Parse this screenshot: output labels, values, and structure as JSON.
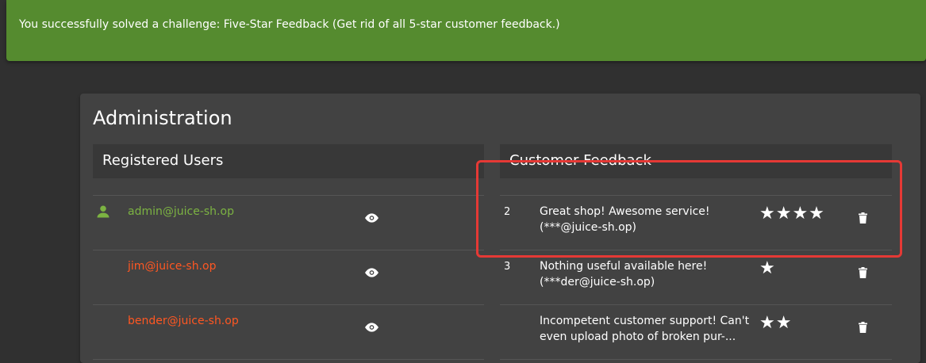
{
  "notification": {
    "message": "You successfully solved a challenge: Five-Star Feedback (Get rid of all 5-star customer feedback.)",
    "color": "#558b2f"
  },
  "administration": {
    "title": "Administration",
    "registered_users": {
      "header": "Registered Users",
      "users": [
        {
          "email": "admin@juice-sh.op",
          "color": "#7cb342",
          "icon": "user-icon"
        },
        {
          "email": "jim@juice-sh.op",
          "color": "#ff5722"
        },
        {
          "email": "bender@juice-sh.op",
          "color": "#ff5722"
        }
      ]
    },
    "customer_feedback": {
      "header": "Customer Feedback",
      "feedbacks": [
        {
          "id": "2",
          "comment": "Great shop! Awesome service! (***@juice-sh.op)",
          "rating": 4,
          "stars": "★★★★"
        },
        {
          "id": "3",
          "comment": "Nothing useful available here! (***der@juice-sh.op)",
          "rating": 1,
          "stars": "★"
        },
        {
          "id": "",
          "comment": "Incompetent customer support! Can't even upload photo of broken pur-...",
          "rating": 2,
          "stars": "★★"
        }
      ]
    }
  },
  "annotation": {
    "color": "#e53935"
  }
}
